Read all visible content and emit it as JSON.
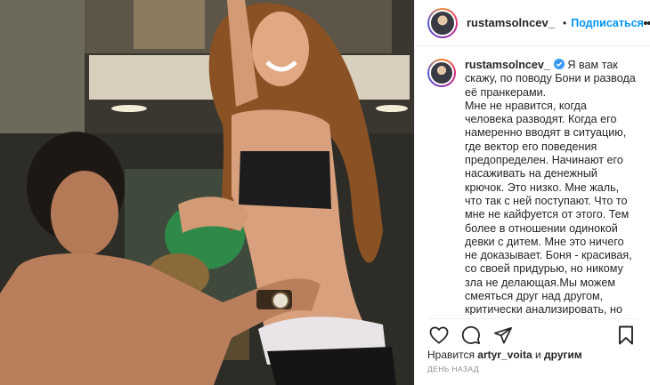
{
  "header": {
    "username": "rustamsolncev_",
    "separator": "•",
    "follow_label": "Подписаться"
  },
  "caption": {
    "username": "rustamsolncev_",
    "text": " Я вам так скажу, по поводу Бони и развода её пранкерами.\nМне не нравится, когда человека разводят. Когда его намеренно вводят в ситуацию, где вектор его поведения предопределен. Начинают его насаживать на денежный крючок. Это низко. Мне жаль, что так с ней поступают. Что то мне не кайфуется от этого. Тем более в отношении одинокой девки с дитем. Мне это ничего не доказывает. Боня - красивая, со своей придурью, но никому зла не делающая.Мы можем смеяться друг над другом, критически анализировать, но подлости- нет. Этот пранк пусть в пизду идёт."
  },
  "likes": {
    "prefix": "Нравится ",
    "user": "artyr_voita",
    "suffix": " и ",
    "others": "другим"
  },
  "timestamp": "День назад",
  "icons": {
    "verified": "verified-badge-icon",
    "like": "heart-icon",
    "comment": "comment-icon",
    "share": "paper-plane-icon",
    "save": "bookmark-icon",
    "more": "more-options-icon"
  },
  "colors": {
    "accent": "#0095f6",
    "text": "#262626",
    "muted": "#8e8e8e",
    "verified": "#3897f0"
  }
}
